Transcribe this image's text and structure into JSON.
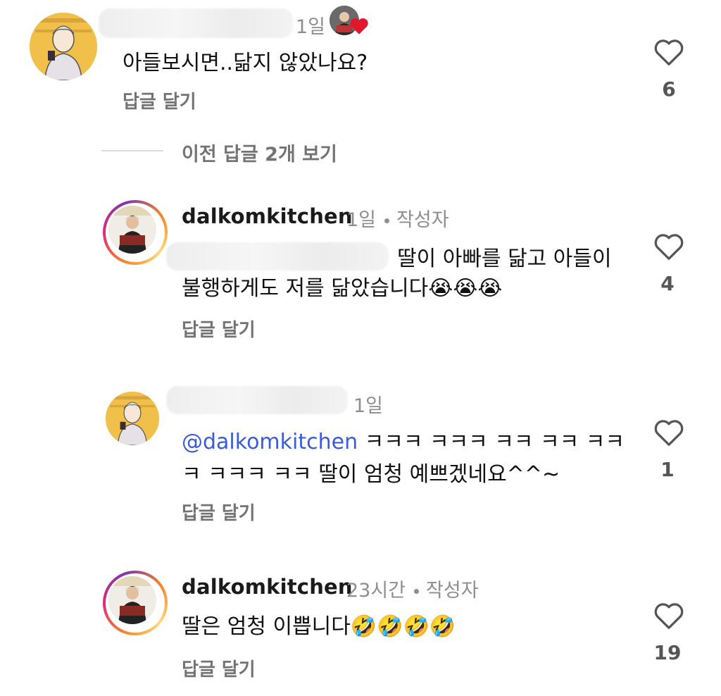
{
  "comments": [
    {
      "text": "아들보시면..닮지 않았나요?",
      "time": "1일",
      "likes": "6",
      "reply_label": "답글 달기"
    },
    {
      "username": "dalkomkitchen",
      "time": "1일",
      "author_tag": "작성자",
      "text_line1": "딸이 아빠를 닮고 아들이",
      "text_line2": "불행하게도 저를 닮았습니다",
      "emoji": "😭😭😭",
      "likes": "4",
      "reply_label": "답글 달기"
    },
    {
      "time": "1일",
      "mention": "@dalkomkitchen",
      "text_line1": " ㅋㅋㅋ ㅋㅋㅋ ㅋㅋ ㅋㅋ ㅋㅋ",
      "text_line2": "ㅋ ㅋㅋㅋ ㅋㅋ  딸이 엄청 예쁘겠네요^^~",
      "likes": "1",
      "reply_label": "답글 달기"
    },
    {
      "username": "dalkomkitchen",
      "time": "23시간",
      "author_tag": "작성자",
      "text": "딸은 엄청 이쁩니다",
      "emoji": "🤣🤣🤣🤣",
      "likes": "19",
      "reply_label": "답글 달기"
    }
  ],
  "view_previous": "이전 답글 2개 보기",
  "colors": {
    "mention": "#3b5bd8",
    "liked_heart": "#e0182d",
    "meta": "#8e8e8e"
  },
  "icons": [
    "heart-icon",
    "liked-heart-icon",
    "avatar",
    "story-ring"
  ]
}
